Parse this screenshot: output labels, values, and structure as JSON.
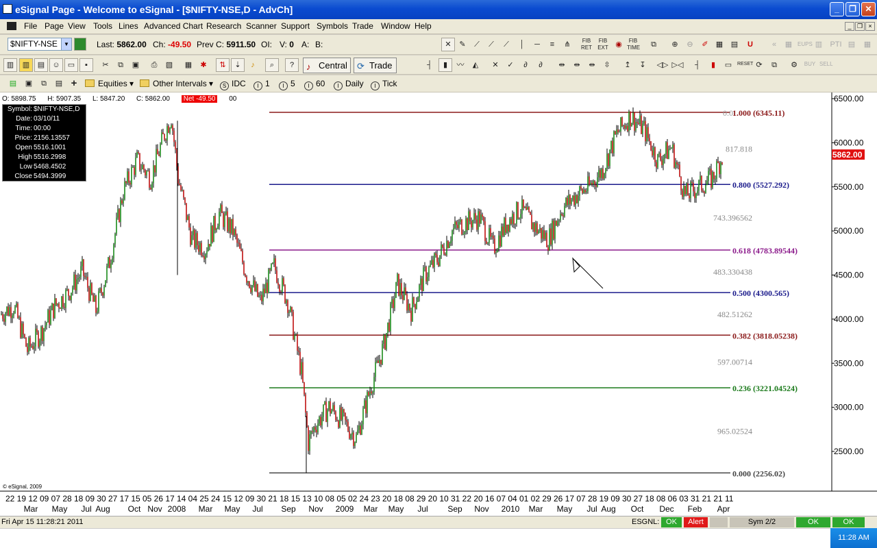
{
  "window": {
    "title": "eSignal Page - Welcome to eSignal - [$NIFTY-NSE,D - AdvCh]",
    "minimize": "_",
    "maximize": "❐",
    "close": "✕"
  },
  "menu": {
    "items": [
      "File",
      "Page",
      "View",
      "Tools",
      "Lines",
      "Advanced Chart",
      "Research",
      "Scanner",
      "Support",
      "Symbols",
      "Trade",
      "Window",
      "Help"
    ]
  },
  "quote_bar": {
    "symbol": "$NIFTY-NSE",
    "last_label": "Last:",
    "last_value": "5862.00",
    "change_label": "Ch:",
    "change_value": "-49.50",
    "prev_label": "Prev C:",
    "prev_value": "5911.50",
    "oi_label": "OI:",
    "volume_label": "V:",
    "volume_value": "0",
    "ask_label": "A:",
    "bid_label": "B:"
  },
  "toolbar2": {
    "central_label": "Central",
    "trade_label": "Trade",
    "fib_ret": "FIB RET",
    "fib_ext": "FIB EXT",
    "fib_time": "FIB TIME",
    "eups": "EUPS",
    "pti": "PTI",
    "reset": "RESET",
    "buy": "BUY",
    "sell": "SELL"
  },
  "interval_bar": {
    "equities": "Equities",
    "other_intervals": "Other Intervals",
    "idc": "IDC",
    "i1": "1",
    "i5": "5",
    "i60": "60",
    "daily": "Daily",
    "tick": "Tick"
  },
  "ohlc_strip": {
    "open": "O: 5898.75",
    "high": "H: 5907.35",
    "low": "L: 5847.20",
    "close": "C: 5862.00",
    "net": "Net -49.50",
    "trail": "00"
  },
  "data_window": {
    "rows": [
      {
        "k": "Symbol:",
        "v": "$NIFTY-NSE,D"
      },
      {
        "k": "Date:",
        "v": "03/10/11"
      },
      {
        "k": "Time:",
        "v": "00:00"
      },
      {
        "k": "Price:",
        "v": "2156.13557"
      },
      {
        "k": "Open",
        "v": "5516.1001"
      },
      {
        "k": "High",
        "v": "5516.2998"
      },
      {
        "k": "Low",
        "v": "5468.4502"
      },
      {
        "k": "Close",
        "v": "5494.3999"
      }
    ]
  },
  "copyright": "© eSignal, 2009",
  "chart_data": {
    "type": "line",
    "title": "",
    "y_ticks": [
      "6500.00",
      "6000.00",
      "5500.00",
      "5000.00",
      "4500.00",
      "4000.00",
      "3500.00",
      "3000.00",
      "2500.00"
    ],
    "ylim": [
      2250,
      6550
    ],
    "last_price_tag": "5862.00",
    "fib_levels": [
      {
        "label": "0.0",
        "value": "1.000 (6345.11)",
        "price": 6345.11,
        "color": "#8b1a1a"
      },
      {
        "label": "",
        "value": "0.800 (5527.292)",
        "price": 5527.292,
        "color": "#1a1a8b"
      },
      {
        "label": "",
        "value": "0.618 (4783.89544)",
        "price": 4783.89544,
        "color": "#8b1a8b"
      },
      {
        "label": "",
        "value": "0.500 (4300.565)",
        "price": 4300.565,
        "color": "#1a1a8b"
      },
      {
        "label": "",
        "value": "0.382 (3818.05238)",
        "price": 3818.05238,
        "color": "#8b1a1a"
      },
      {
        "label": "",
        "value": "0.236 (3221.04524)",
        "price": 3221.04524,
        "color": "#1a7a1a"
      },
      {
        "label": "",
        "value": "0.000 (2256.02)",
        "price": 2256.02,
        "color": "#444444"
      }
    ],
    "fib_gap_labels": [
      "817.818",
      "743.396562",
      "483.330438",
      "482.51262",
      "597.00714",
      "965.02524"
    ],
    "x_day_labels": [
      "22",
      "19",
      "12",
      "09",
      "07",
      "28",
      "18",
      "09",
      "30",
      "27",
      "17",
      "15",
      "05",
      "26",
      "17",
      "14",
      "04",
      "25",
      "24",
      "15",
      "12",
      "09",
      "30",
      "21",
      "18",
      "15",
      "13",
      "10",
      "08",
      "05",
      "02",
      "24",
      "23",
      "20",
      "18",
      "08",
      "29",
      "20",
      "10",
      "31",
      "22",
      "20",
      "16",
      "07",
      "04",
      "01",
      "02",
      "29",
      "26",
      "17",
      "07",
      "28",
      "19",
      "09",
      "30",
      "27",
      "18",
      "08",
      "06",
      "03",
      "31",
      "21",
      "21",
      "11"
    ],
    "x_month_labels": [
      "Mar",
      "May",
      "Jul",
      "Aug",
      "Oct",
      "Nov",
      "2008",
      "Mar",
      "May",
      "Jul",
      "Sep",
      "Nov",
      "2009",
      "Mar",
      "May",
      "Jul",
      "Sep",
      "Nov",
      "2010",
      "Mar",
      "May",
      "Jul",
      "Aug",
      "Oct",
      "Dec",
      "Feb",
      "Apr"
    ],
    "series": [
      {
        "x": [
          0,
          20,
          40,
          60,
          80,
          100,
          120,
          140,
          160,
          180,
          200,
          220,
          240,
          250,
          260,
          280,
          300,
          320,
          340,
          360,
          380,
          400,
          420,
          440,
          450,
          460,
          480,
          500,
          520,
          540,
          560,
          580,
          600,
          620,
          640,
          660,
          680,
          700,
          720,
          740,
          760,
          780,
          800,
          820,
          840,
          860,
          880,
          900,
          920,
          940,
          960,
          980,
          1000,
          1020,
          1040,
          1055
        ],
        "values": [
          4050,
          4150,
          3650,
          3850,
          4150,
          4300,
          4550,
          4100,
          4650,
          5450,
          5800,
          5600,
          6100,
          6300,
          5600,
          4900,
          4800,
          5200,
          5000,
          4500,
          4200,
          4600,
          4200,
          3400,
          2600,
          2800,
          3000,
          2850,
          2650,
          3200,
          3700,
          4400,
          4100,
          4500,
          4700,
          5000,
          5100,
          5150,
          4800,
          5100,
          5250,
          5050,
          4900,
          5250,
          5400,
          5500,
          5700,
          6100,
          6300,
          6150,
          5800,
          5950,
          5400,
          5500,
          5600,
          5862
        ]
      }
    ]
  },
  "status": {
    "datetime": "Fri Apr 15 11:28:21 2011",
    "esgnl": "ESGNL:",
    "ok1": "OK",
    "alert": "Alert",
    "sym": "Sym 2/2",
    "ok2": "OK",
    "ok3": "OK"
  },
  "tray": {
    "time": "11:28 AM"
  }
}
